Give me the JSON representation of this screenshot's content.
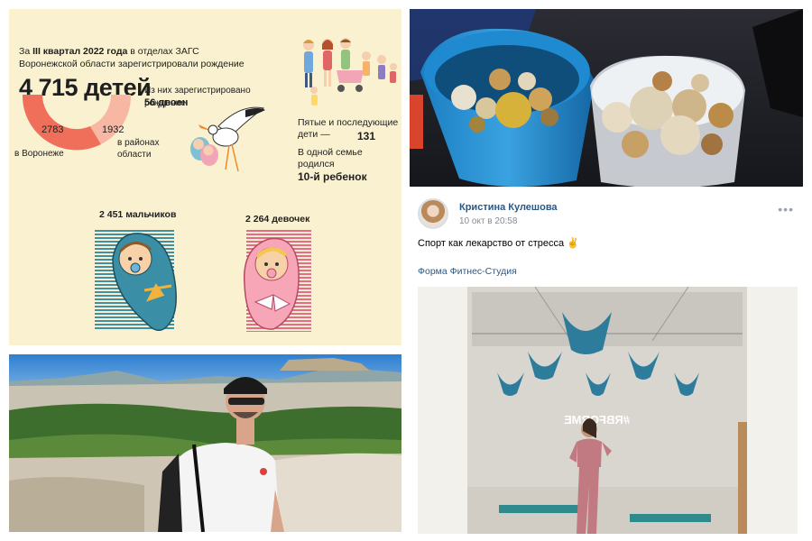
{
  "infographic": {
    "headline_prefix": "За ",
    "headline_bold": "III квартал 2022 года",
    "headline_rest": " в отделах ЗАГС Воронежской области зарегистрировали рождение",
    "total": "4 715 детей",
    "voronezh_value": "2783",
    "voronezh_label": "в Воронеже",
    "districts_value": "1932",
    "districts_label": "в районах области",
    "twins_caption": "Из них зарегистрировано рождение",
    "twins_value": "56 двоен",
    "fifth_caption": "Пятые и последующие дети —",
    "fifth_value": "131",
    "family_caption": "В одной семье родился",
    "family_value": "10-й ребенок",
    "boys_label": "2 451 мальчиков",
    "girls_label": "2 264 девочек",
    "colors": {
      "background": "#f9f1cf",
      "voronezh": "#ef6f5a",
      "districts": "#f7b7a3",
      "boys": "#3f8fa6",
      "girls": "#e86a8b"
    }
  },
  "vk_post": {
    "author": "Кристина Кулешова",
    "time": "10 окт в 20:58",
    "more_icon": "•••",
    "text": "Спорт как лекарство от стресса",
    "emoji": "✌",
    "source": "Форма Фитнес-Студия",
    "studio_sign": "#RBFORME"
  }
}
